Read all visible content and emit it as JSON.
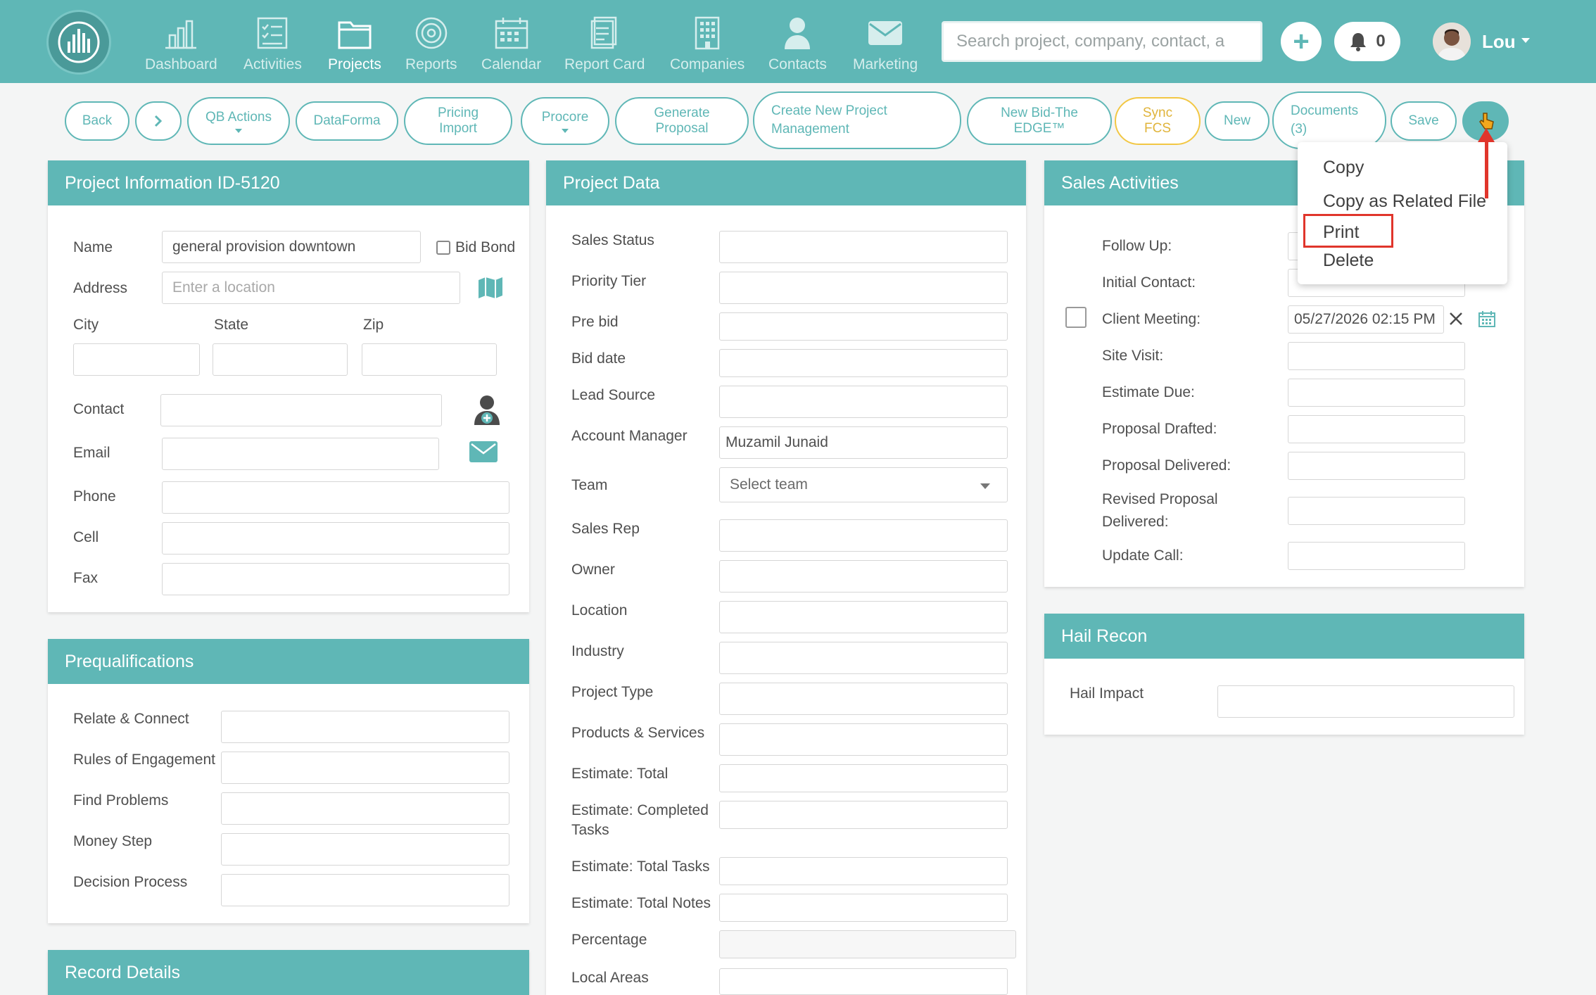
{
  "nav": {
    "items": [
      {
        "label": "Dashboard",
        "icon": "bar-chart-icon"
      },
      {
        "label": "Activities",
        "icon": "checklist-icon"
      },
      {
        "label": "Projects",
        "icon": "folder-icon"
      },
      {
        "label": "Reports",
        "icon": "target-icon"
      },
      {
        "label": "Calendar",
        "icon": "calendar-icon"
      },
      {
        "label": "Report Card",
        "icon": "document-icon"
      },
      {
        "label": "Companies",
        "icon": "building-icon"
      },
      {
        "label": "Contacts",
        "icon": "person-icon"
      },
      {
        "label": "Marketing",
        "icon": "envelope-icon"
      }
    ],
    "search_placeholder": "Search project, company, contact, a",
    "notification_count": "0",
    "user_name": "Lou"
  },
  "actions": {
    "back": "Back",
    "qb_actions": "QB Actions",
    "dataforma": "DataForma",
    "pricing_import_1": "Pricing",
    "pricing_import_2": "Import",
    "procore": "Procore",
    "generate_proposal_1": "Generate",
    "generate_proposal_2": "Proposal",
    "create_pm_1": "Create New Project",
    "create_pm_2": "Management",
    "new_bid_1": "New Bid-The",
    "new_bid_2": "EDGE™",
    "sync_fcs_1": "Sync",
    "sync_fcs_2": "FCS",
    "new": "New",
    "documents_1": "Documents",
    "documents_2": "(3)",
    "save": "Save"
  },
  "menu": {
    "items": [
      "Copy",
      "Copy as Related File",
      "Print",
      "Delete"
    ]
  },
  "project_info": {
    "title": "Project Information ID-5120",
    "name_label": "Name",
    "name_value": "general provision downtown",
    "bid_bond": "Bid Bond",
    "address_label": "Address",
    "address_placeholder": "Enter a location",
    "city": "City",
    "state": "State",
    "zip": "Zip",
    "contact": "Contact",
    "email": "Email",
    "phone": "Phone",
    "cell": "Cell",
    "fax": "Fax"
  },
  "prequal": {
    "title": "Prequalifications",
    "fields": [
      "Relate & Connect",
      "Rules of Engagement",
      "Find Problems",
      "Money Step",
      "Decision Process"
    ]
  },
  "record_details": {
    "title": "Record Details"
  },
  "project_data": {
    "title": "Project Data",
    "sales_status": "Sales Status",
    "priority_tier": "Priority Tier",
    "pre_bid": "Pre bid",
    "bid_date": "Bid date",
    "lead_source": "Lead Source",
    "account_manager": "Account Manager",
    "account_manager_value": "Muzamil Junaid",
    "team": "Team",
    "team_placeholder": "Select team",
    "sales_rep": "Sales Rep",
    "owner": "Owner",
    "location": "Location",
    "industry": "Industry",
    "project_type": "Project Type",
    "products_services": "Products & Services",
    "estimate_total": "Estimate: Total",
    "estimate_completed_1": "Estimate: Completed",
    "estimate_completed_2": "Tasks",
    "estimate_total_tasks": "Estimate: Total Tasks",
    "estimate_total_notes": "Estimate: Total Notes",
    "percentage": "Percentage",
    "local_areas": "Local Areas"
  },
  "sales_activities": {
    "title": "Sales Activities",
    "follow_up": "Follow Up:",
    "initial_contact": "Initial Contact:",
    "client_meeting": "Client Meeting:",
    "client_meeting_value": "05/27/2026 02:15 PM",
    "site_visit": "Site Visit:",
    "estimate_due": "Estimate Due:",
    "proposal_drafted": "Proposal Drafted:",
    "proposal_delivered": "Proposal Delivered:",
    "revised_1": "Revised Proposal",
    "revised_2": "Delivered:",
    "update_call": "Update Call:"
  },
  "hail_recon": {
    "title": "Hail Recon",
    "hail_impact": "Hail Impact"
  },
  "colors": {
    "teal": "#5fb7b6",
    "highlight_red": "#e0352b",
    "sync_yellow": "#f2c744"
  }
}
